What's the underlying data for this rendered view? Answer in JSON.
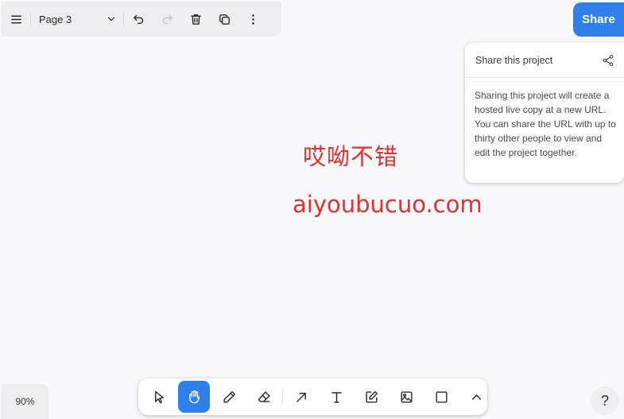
{
  "header": {
    "page_name": "Page 3"
  },
  "share": {
    "button_label": "Share",
    "popover_title": "Share this project",
    "popover_text": "Sharing this project will create a hosted live copy at a new URL. You can share the URL with up to thirty other people to view and edit the project together."
  },
  "canvas": {
    "text_1": "哎呦不错",
    "text_2": "aiyoubucuo.com",
    "text_color": "#e03131",
    "background": "#f9f9fb"
  },
  "zoom": {
    "level": "90%"
  },
  "help": {
    "label": "?"
  },
  "toolbar": {
    "tools": [
      "select",
      "hand",
      "draw",
      "eraser",
      "arrow",
      "text",
      "note",
      "asset",
      "rectangle",
      "more"
    ],
    "active_tool": "hand"
  },
  "colors": {
    "accent": "#2f80ed",
    "panel": "#eeeef1"
  },
  "icons": {
    "menu": "menu-icon",
    "page_dropdown": "chevron-down-icon",
    "undo": "undo-icon",
    "redo": "redo-icon",
    "delete": "trash-icon",
    "duplicate": "duplicate-icon",
    "more": "more-vertical-icon",
    "share_link": "share-nodes-icon"
  }
}
